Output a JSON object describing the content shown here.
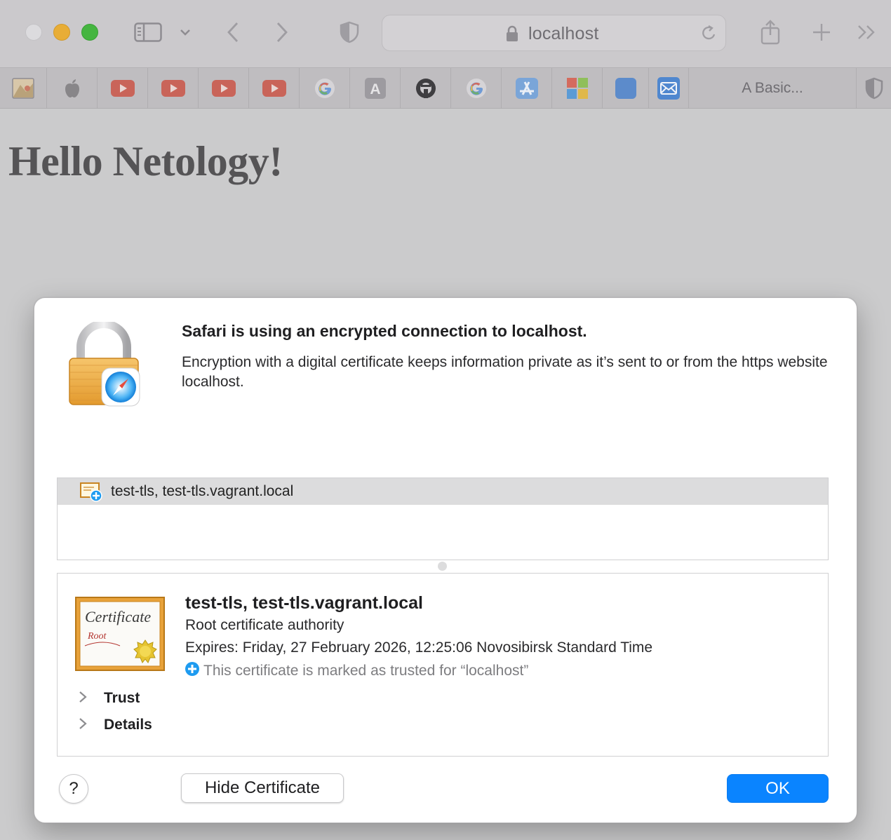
{
  "window": {
    "traffic_lights": [
      "close",
      "minimize",
      "zoom"
    ],
    "colors": {
      "minimize": "#e8ad36",
      "zoom": "#45b540",
      "accent": "#0a84ff"
    }
  },
  "toolbar": {
    "icons": [
      "sidebar-icon",
      "chevron-down-icon",
      "back-icon",
      "forward-icon",
      "privacy-shield-icon",
      "share-icon",
      "new-tab-icon",
      "more-tabs-icon"
    ],
    "address": {
      "text": "localhost",
      "icons": [
        "lock-icon",
        "reload-icon"
      ]
    }
  },
  "tabs": {
    "pinned": [
      "weather-pinned-icon",
      "apple-pinned-icon",
      "youtube-pinned-icon",
      "youtube-pinned-icon",
      "youtube-pinned-icon",
      "youtube-pinned-icon",
      "google-pinned-icon",
      "font-a-pinned-icon",
      "github-pinned-icon",
      "google-pinned-icon",
      "app-store-pinned-icon",
      "microsoft-pinned-icon",
      "blue-square-pinned-icon",
      "mail-pinned-icon"
    ],
    "active_title": "A Basic...",
    "trailing_icon": "shield-pinned-icon"
  },
  "page": {
    "heading": "Hello Netology!"
  },
  "dialog": {
    "title": "Safari is using an encrypted connection to localhost.",
    "description": "Encryption with a digital certificate keeps information private as it’s sent to or from the https website localhost.",
    "chain": {
      "items": [
        {
          "label": "test-tls, test-tls.vagrant.local",
          "selected": true
        }
      ]
    },
    "certificate": {
      "image_text": "Certificate",
      "image_subtext": "Root",
      "name": "test-tls, test-tls.vagrant.local",
      "type": "Root certificate authority",
      "expires": "Expires: Friday, 27 February 2026, 12:25:06 Novosibirsk Standard Time",
      "trusted": "This certificate is marked as trusted for “localhost”",
      "sections": [
        "Trust",
        "Details"
      ]
    },
    "buttons": {
      "help": "?",
      "hide_certificate": "Hide Certificate",
      "ok": "OK"
    }
  }
}
